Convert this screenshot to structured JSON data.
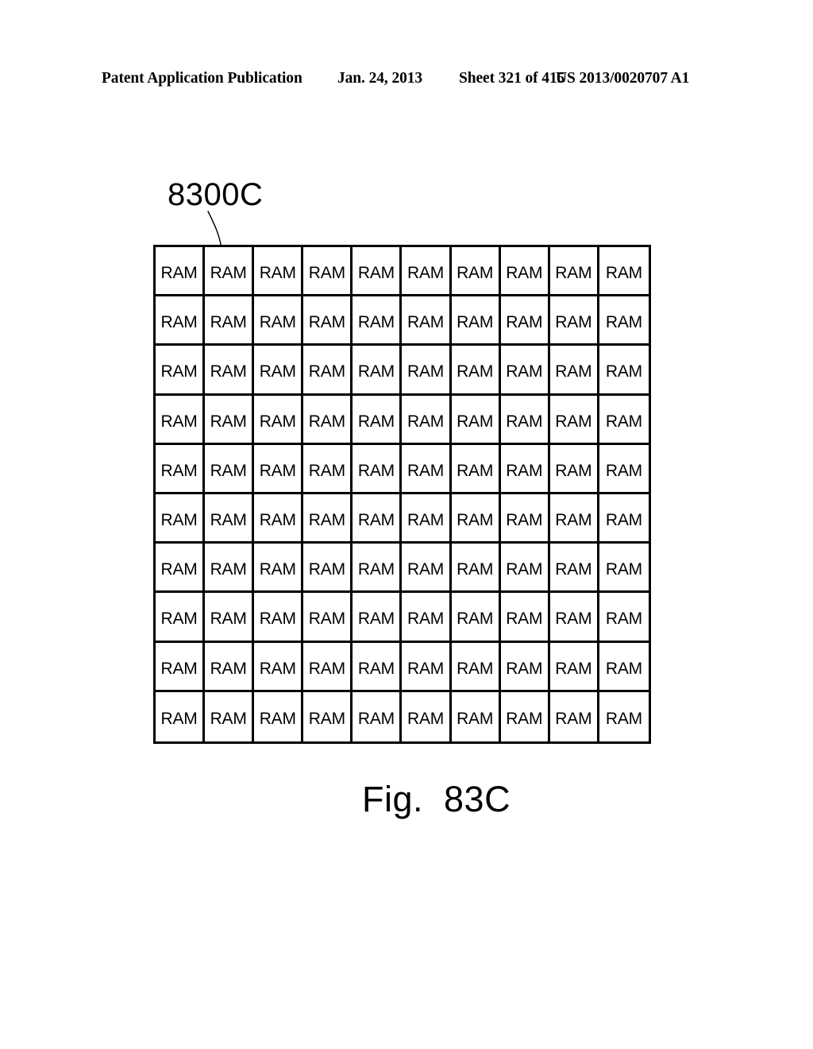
{
  "header": {
    "publication": "Patent Application Publication",
    "date": "Jan. 24, 2013",
    "sheet": "Sheet 321 of 415",
    "patent_number": "US 2013/0020707 A1"
  },
  "figure": {
    "reference_label": "8300C",
    "caption": "Fig.  83C",
    "grid": {
      "rows": 10,
      "columns": 10,
      "cell_label": "RAM",
      "total_cells": 100
    },
    "colors": {
      "line": "#000000",
      "background": "#ffffff"
    }
  }
}
